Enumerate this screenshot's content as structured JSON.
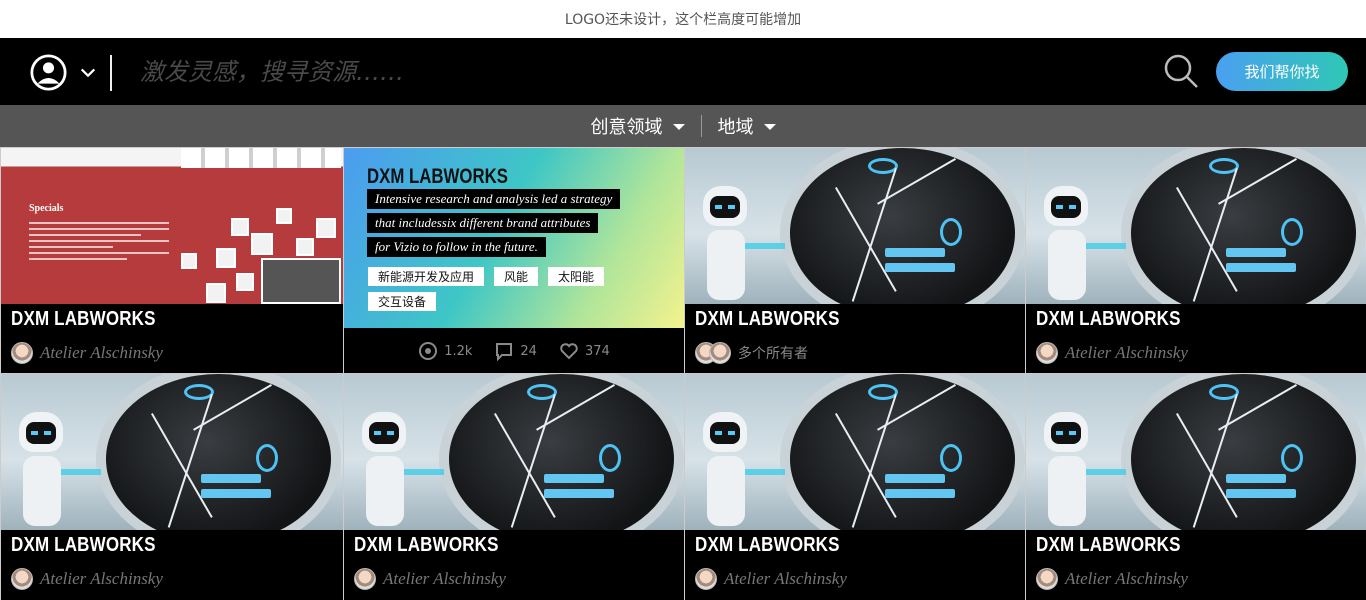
{
  "logo_bar": {
    "text": "LOGO还未设计，这个栏高度可能增加"
  },
  "header": {
    "search_placeholder": "激发灵感，搜寻资源……",
    "help_button": "我们帮你找",
    "accent_gradient": [
      "#4aa0f0",
      "#2fc7b6"
    ]
  },
  "filters": [
    {
      "label": "创意领域",
      "icon": "caret-down-icon"
    },
    {
      "label": "地域",
      "icon": "caret-down-icon"
    }
  ],
  "cards": [
    {
      "title": "DXM LABWORKS",
      "owner": "Atelier Alschinsky",
      "thumb": "exhibition-wall"
    },
    {
      "title": "DXM LABWORKS",
      "thumb": "featured-gradient",
      "description_lines": [
        "Intensive research and analysis led a strategy",
        "that includessix different brand attributes",
        "for Vizio to follow in the future."
      ],
      "tags": [
        "新能源开发及应用",
        "风能",
        "太阳能",
        "交互设备"
      ],
      "stats": {
        "views": "1.2k",
        "comments": "24",
        "likes": "374"
      }
    },
    {
      "title": "DXM LABWORKS",
      "owner": "多个所有者",
      "thumb": "robot"
    },
    {
      "title": "DXM LABWORKS",
      "owner": "Atelier Alschinsky",
      "thumb": "robot"
    },
    {
      "title": "DXM LABWORKS",
      "owner": "Atelier Alschinsky",
      "thumb": "robot"
    },
    {
      "title": "DXM LABWORKS",
      "owner": "Atelier Alschinsky",
      "thumb": "robot"
    },
    {
      "title": "DXM LABWORKS",
      "owner": "Atelier Alschinsky",
      "thumb": "robot"
    },
    {
      "title": "DXM LABWORKS",
      "owner": "Atelier Alschinsky",
      "thumb": "robot"
    }
  ]
}
